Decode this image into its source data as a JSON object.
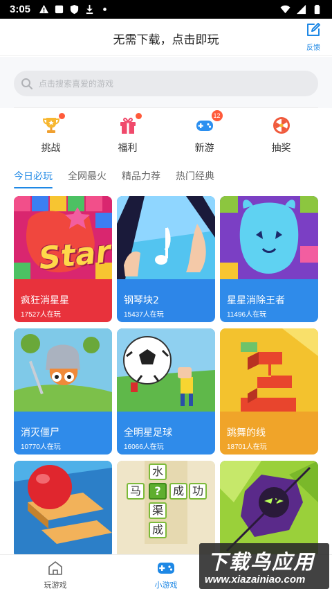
{
  "status_bar": {
    "time": "3:05",
    "left_icons": [
      "warning-icon",
      "square-notification-icon",
      "shield-icon",
      "download-icon",
      "dot-icon"
    ],
    "right_icons": [
      "wifi-icon",
      "cellular-signal-icon",
      "battery-icon"
    ]
  },
  "header": {
    "title": "无需下载，点击即玩",
    "feedback_label": "反馈",
    "feedback_icon": "edit-icon"
  },
  "search": {
    "placeholder": "点击搜索喜爱的游戏",
    "icon": "search-icon"
  },
  "quick_nav": [
    {
      "label": "挑战",
      "icon": "trophy-icon",
      "has_dot": true
    },
    {
      "label": "福利",
      "icon": "gift-icon",
      "has_dot": true
    },
    {
      "label": "新游",
      "icon": "gamepad-icon",
      "badge": "12"
    },
    {
      "label": "抽奖",
      "icon": "prize-wheel-icon"
    }
  ],
  "category_tabs": [
    {
      "label": "今日必玩",
      "active": true
    },
    {
      "label": "全网最火",
      "active": false
    },
    {
      "label": "精品力荐",
      "active": false
    },
    {
      "label": "热门经典",
      "active": false
    }
  ],
  "games": [
    {
      "name": "疯狂消星星",
      "players": "17527人在玩",
      "color": "#e8323c",
      "art_text": "Star"
    },
    {
      "name": "钢琴块2",
      "players": "15437人在玩",
      "color": "#2d86e8"
    },
    {
      "name": "星星消除王者",
      "players": "11496人在玩",
      "color": "#2f8bea"
    },
    {
      "name": "消灭僵尸",
      "players": "10770人在玩",
      "color": "#2f8bea"
    },
    {
      "name": "全明星足球",
      "players": "16066人在玩",
      "color": "#2f8bea"
    },
    {
      "name": "跳舞的线",
      "players": "18701人在玩",
      "color": "#f0a429"
    },
    {
      "name": "",
      "players": "",
      "color": "#2d86e8"
    },
    {
      "name": "",
      "players": "",
      "color": "#7cba3a",
      "art_chars": [
        "水",
        "马",
        "?",
        "成",
        "功",
        "渠",
        "成"
      ]
    },
    {
      "name": "",
      "players": "",
      "color": "#6a3ab0"
    }
  ],
  "bottom_nav": [
    {
      "label": "玩游戏",
      "icon": "home-icon",
      "active": false
    },
    {
      "label": "小游戏",
      "icon": "gamepad-icon",
      "active": true
    }
  ],
  "watermark": {
    "title": "下载鸟应用",
    "url": "www.xiazainiao.com"
  },
  "colors": {
    "accent": "#1e88e5",
    "badge": "#ff5a3a"
  }
}
